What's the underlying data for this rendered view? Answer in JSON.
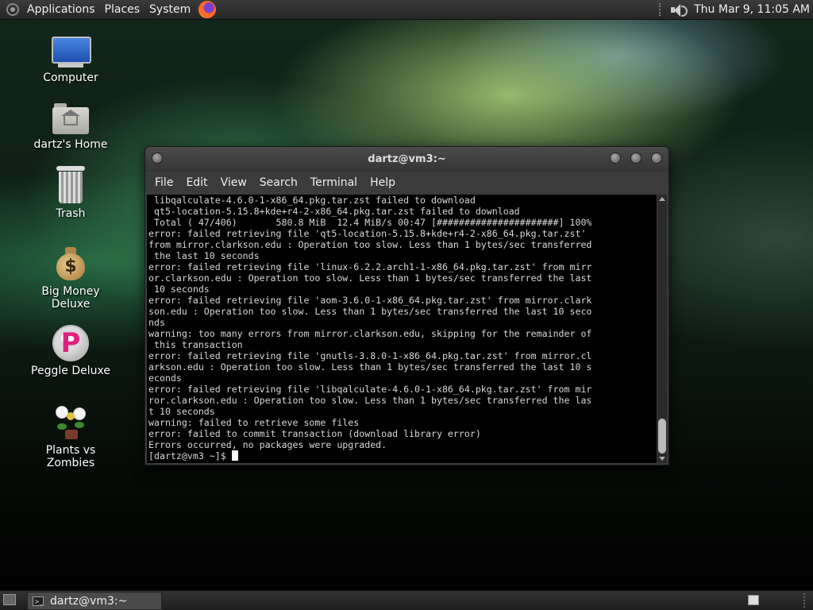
{
  "top_panel": {
    "menus": [
      "Applications",
      "Places",
      "System"
    ],
    "clock": "Thu Mar  9, 11:05 AM"
  },
  "desktop_icons": [
    {
      "label": "Computer",
      "icon": "computer-icon"
    },
    {
      "label": "dartz's Home",
      "icon": "home-folder-icon"
    },
    {
      "label": "Trash",
      "icon": "trash-icon"
    },
    {
      "label": "Big Money Deluxe",
      "icon": "money-bag-icon"
    },
    {
      "label": "Peggle Deluxe",
      "icon": "peggle-icon"
    },
    {
      "label": "Plants vs Zombies",
      "icon": "plants-vs-zombies-icon"
    }
  ],
  "terminal": {
    "title": "dartz@vm3:~",
    "menu": [
      "File",
      "Edit",
      "View",
      "Search",
      "Terminal",
      "Help"
    ],
    "lines": [
      " libqalculate-4.6.0-1-x86_64.pkg.tar.zst failed to download",
      " qt5-location-5.15.8+kde+r4-2-x86_64.pkg.tar.zst failed to download",
      " Total ( 47/406)       580.8 MiB  12.4 MiB/s 00:47 [######################] 100%",
      "error: failed retrieving file 'qt5-location-5.15.8+kde+r4-2-x86_64.pkg.tar.zst'",
      "from mirror.clarkson.edu : Operation too slow. Less than 1 bytes/sec transferred",
      " the last 10 seconds",
      "error: failed retrieving file 'linux-6.2.2.arch1-1-x86_64.pkg.tar.zst' from mirr",
      "or.clarkson.edu : Operation too slow. Less than 1 bytes/sec transferred the last",
      " 10 seconds",
      "error: failed retrieving file 'aom-3.6.0-1-x86_64.pkg.tar.zst' from mirror.clark",
      "son.edu : Operation too slow. Less than 1 bytes/sec transferred the last 10 seco",
      "nds",
      "warning: too many errors from mirror.clarkson.edu, skipping for the remainder of",
      " this transaction",
      "error: failed retrieving file 'gnutls-3.8.0-1-x86_64.pkg.tar.zst' from mirror.cl",
      "arkson.edu : Operation too slow. Less than 1 bytes/sec transferred the last 10 s",
      "econds",
      "error: failed retrieving file 'libqalculate-4.6.0-1-x86_64.pkg.tar.zst' from mir",
      "ror.clarkson.edu : Operation too slow. Less than 1 bytes/sec transferred the las",
      "t 10 seconds",
      "warning: failed to retrieve some files",
      "error: failed to commit transaction (download library error)",
      "Errors occurred, no packages were upgraded."
    ],
    "prompt": "[dartz@vm3 ~]$ "
  },
  "bottom_panel": {
    "task_label": "dartz@vm3:~"
  }
}
